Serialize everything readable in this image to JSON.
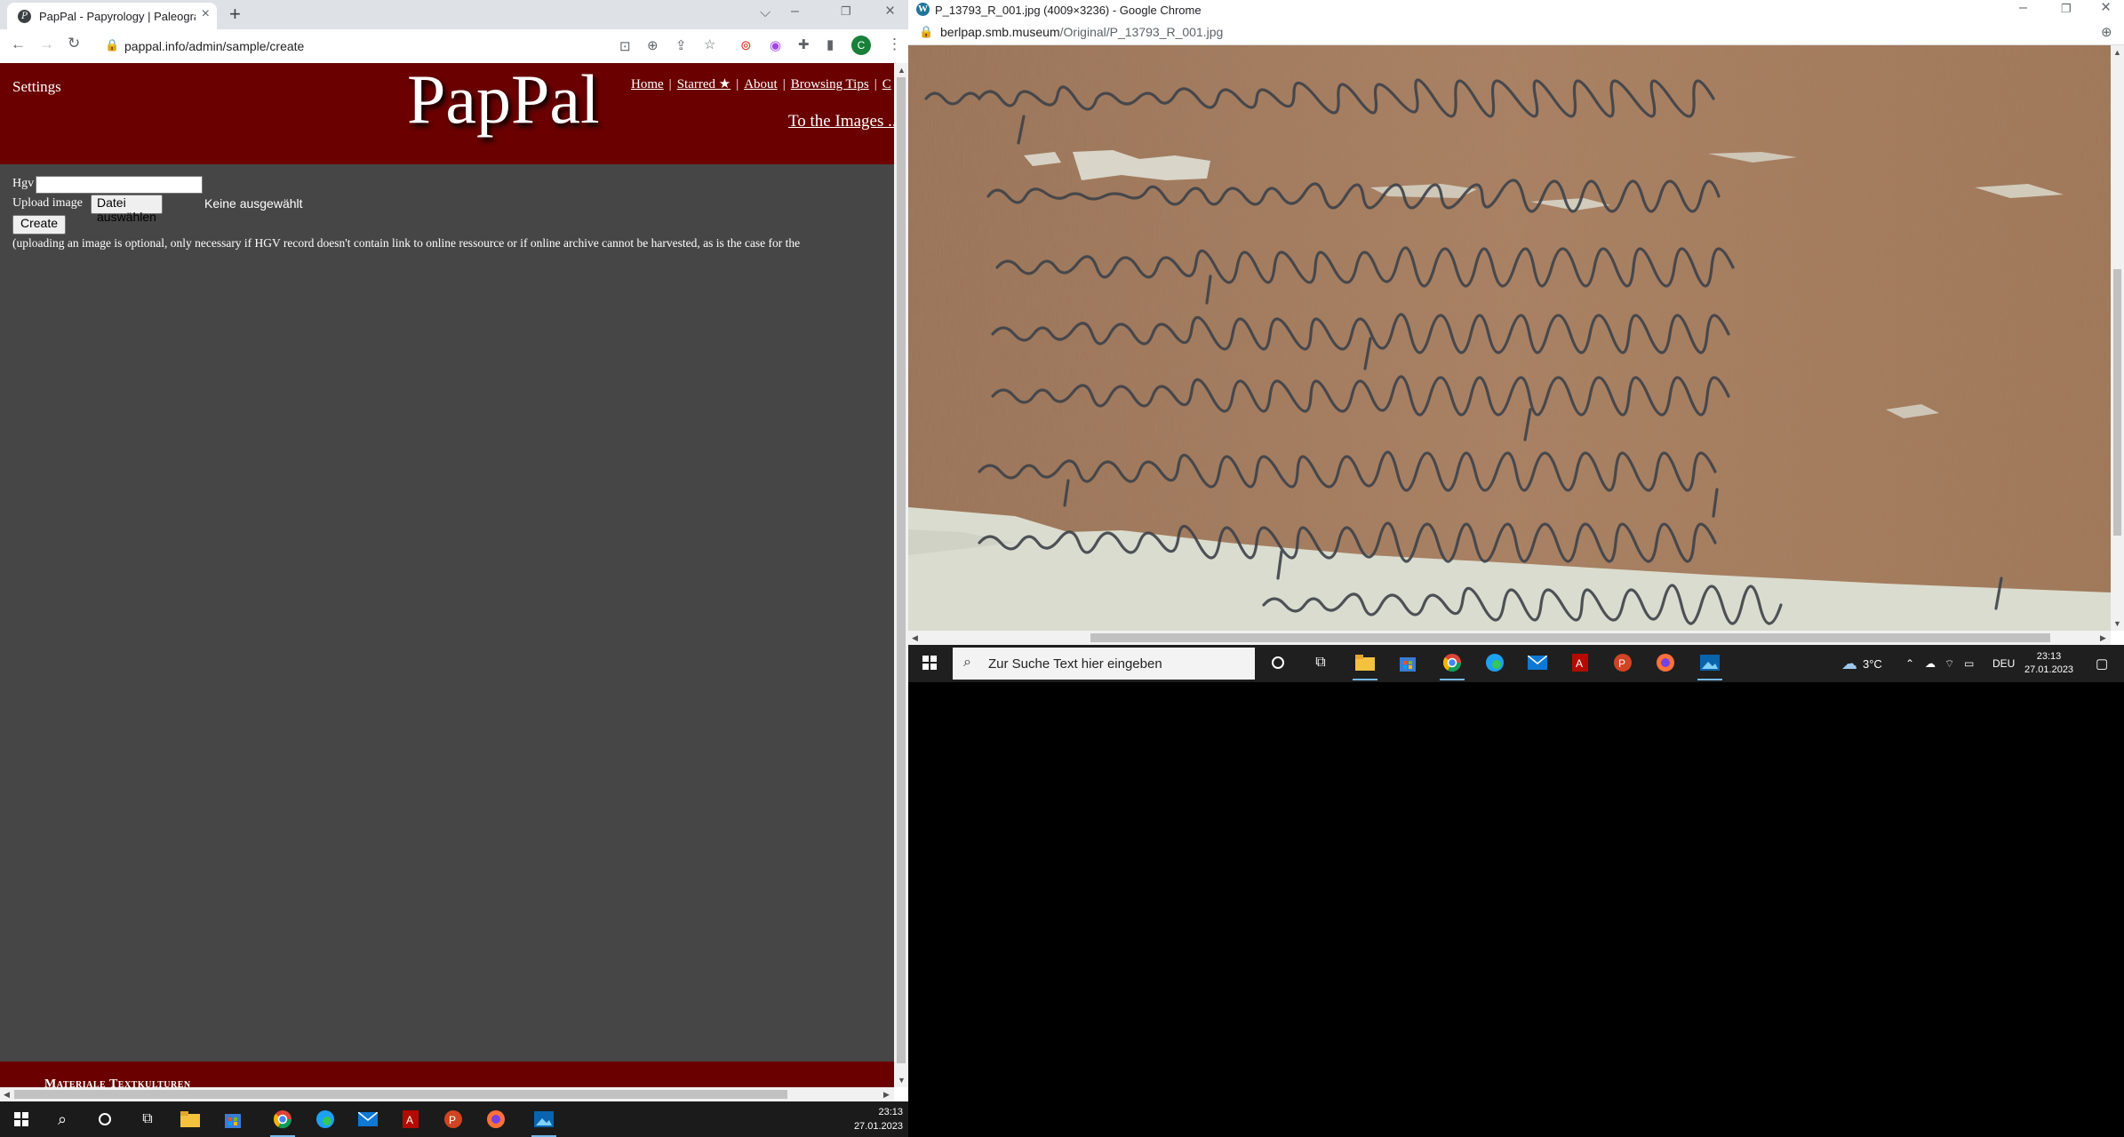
{
  "left_window": {
    "tab_title": "PapPal - Papyrology | Paleograph",
    "favicon_letter": "P",
    "url": "pappal.info/admin/sample/create",
    "profile_initial": "C",
    "page": {
      "settings_label": "Settings",
      "logo": "PapPal",
      "nav": [
        "Home",
        "Starred ★",
        "About",
        "Browsing Tips",
        "C"
      ],
      "to_images": "To the Images ...",
      "form": {
        "hgv_label": "Hgv",
        "hgv_value": "",
        "upload_label": "Upload image",
        "file_button": "Datei auswählen",
        "file_status": "Keine ausgewählt",
        "create_button": "Create",
        "note": "(uploading an image is optional, only necessary if HGV record doesn't contain link to online ressource or if online archive cannot be harvested, as is the case for the"
      },
      "footer_text": "Materiale Textkulturen"
    },
    "taskbar": {
      "time": "23:13",
      "date": "27.01.2023"
    }
  },
  "right_window": {
    "title": "P_13793_R_001.jpg (4009×3236) - Google Chrome",
    "url_host": "berlpap.smb.museum",
    "url_path": "/Original/P_13793_R_001.jpg",
    "taskbar": {
      "search_placeholder": "Zur Suche Text hier eingeben",
      "weather": "3°C",
      "language": "DEU",
      "time": "23:13",
      "date": "27.01.2023"
    }
  },
  "colors": {
    "pappal_red": "#6b0000",
    "page_bg": "#464646",
    "papyrus": "#a57c5e",
    "ink": "#3d4148"
  }
}
